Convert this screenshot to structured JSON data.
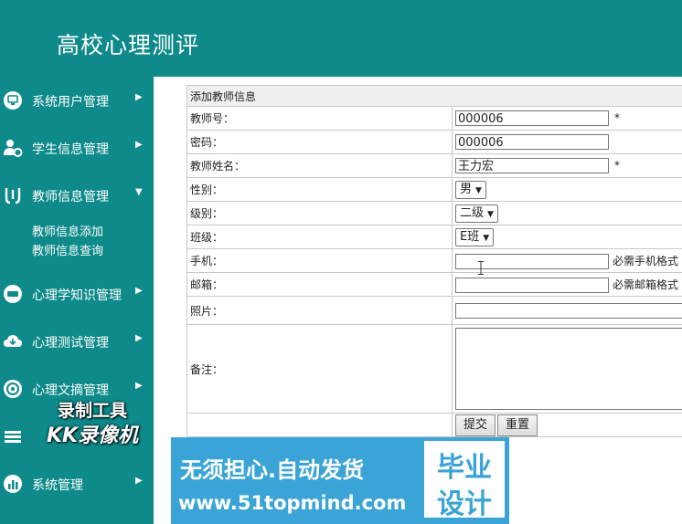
{
  "app": {
    "title": "高校心理测评"
  },
  "sidebar": {
    "items": [
      {
        "label": "系统用户管理",
        "icon": "monitor-icon",
        "chevron": "▶"
      },
      {
        "label": "学生信息管理",
        "icon": "user-gear-icon",
        "chevron": "▶"
      },
      {
        "label": "教师信息管理",
        "icon": "tools-icon",
        "chevron": "▼"
      },
      {
        "label": "心理学知识管理",
        "icon": "app-badge-icon",
        "chevron": "▶"
      },
      {
        "label": "心理测试管理",
        "icon": "cloud-icon",
        "chevron": "▶"
      },
      {
        "label": "心理文摘管理",
        "icon": "settings-icon",
        "chevron": "▶"
      },
      {
        "label": "系统管理",
        "icon": "bar-chart-icon",
        "chevron": "▶"
      }
    ],
    "subitems": [
      {
        "label": "教师信息添加"
      },
      {
        "label": "教师信息查询"
      }
    ]
  },
  "form": {
    "caption": "添加教师信息",
    "rows": {
      "teacher_no": {
        "label": "教师号：",
        "value": "000006",
        "required_mark": "*"
      },
      "password": {
        "label": "密码：",
        "value": "000006"
      },
      "name": {
        "label": "教师姓名：",
        "value": "王力宏",
        "required_mark": "*"
      },
      "gender": {
        "label": "性别：",
        "selected": "男"
      },
      "level": {
        "label": "级别：",
        "selected": "二级"
      },
      "class": {
        "label": "班级：",
        "selected": "E班"
      },
      "phone": {
        "label": "手机：",
        "value": "",
        "hint": "必需手机格式"
      },
      "email": {
        "label": "邮箱：",
        "value": "",
        "hint": "必需邮箱格式"
      },
      "photo": {
        "label": "照片："
      },
      "remark": {
        "label": "备注："
      }
    },
    "buttons": {
      "submit": "提交",
      "reset": "重置"
    }
  },
  "overlay": {
    "recorder_line1": "录制工具",
    "recorder_line2": "KK录像机",
    "banner_line1": "无须担心.自动发货",
    "banner_line2": "www.51topmind.com",
    "badge_line1": "毕业",
    "badge_line2": "设计"
  },
  "colors": {
    "sidebar": "#0f8a8a",
    "banner": "#3ba4d6",
    "text_light": "#ffffff"
  }
}
